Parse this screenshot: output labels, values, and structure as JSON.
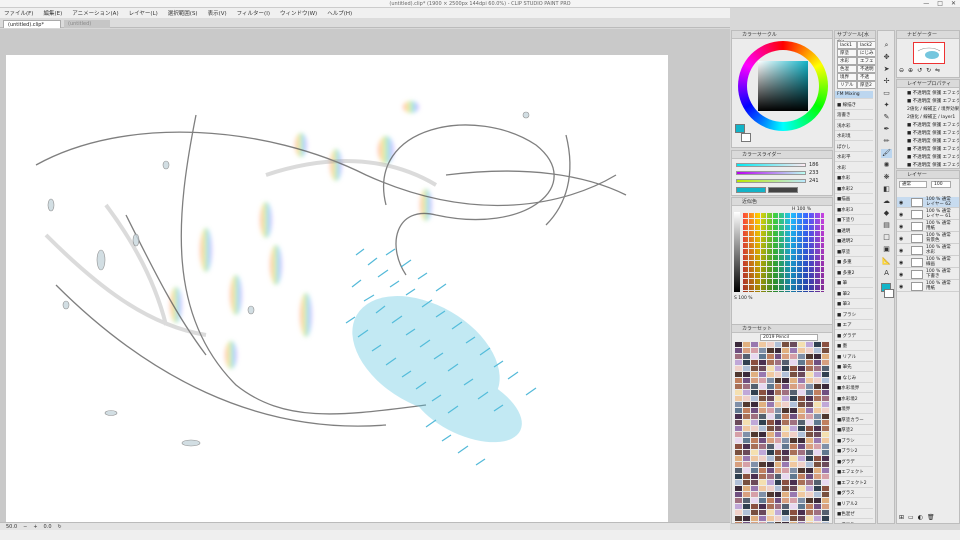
{
  "window": {
    "title": "(untitled).clip* (1900 × 2500px 144dpi 60.0%) - CLIP STUDIO PAINT PRO",
    "controls": [
      "—",
      "□",
      "✕"
    ]
  },
  "menu": [
    "ファイル(F)",
    "編集(E)",
    "アニメーション(A)",
    "レイヤー(L)",
    "選択範囲(S)",
    "表示(V)",
    "フィルター(I)",
    "ウィンドウ(W)",
    "ヘルプ(H)"
  ],
  "tabs": [
    {
      "label": "(untitled).clip*"
    },
    {
      "label": "(untitled)"
    }
  ],
  "status": {
    "zoom": "50.0",
    "angle": "0.0"
  },
  "panels": {
    "color_wheel": "カラーサークル",
    "color_slider": "カラースライダー",
    "approx_color": "近似色",
    "color_set": "カラーセット",
    "color_set_name": "2019 Pencil",
    "subtool": "サブツール[水彩]",
    "navigator": "ナビゲーター",
    "layer_props": "レイヤープロパティ",
    "layers": "レイヤー"
  },
  "slider": {
    "r": "186",
    "g": "233",
    "b": "241"
  },
  "approx": {
    "h_value": "H 100 %",
    "s_value": "S 100 %"
  },
  "subtool_chips": [
    "lack1",
    "lack2",
    "厚塗",
    "にじみ",
    "水彩",
    "エフェ",
    "色混",
    "不透明",
    "境界",
    "不透",
    "リアル",
    "厚塗2"
  ],
  "brushes": [
    "FM Mixing",
    "■ 線描き",
    "溶書き",
    "浅水彩",
    "水彩境",
    "ぼかし",
    "水彩平",
    "水彩",
    "■水彩",
    "■水彩2",
    "■描画",
    "■水彩3",
    "■下塗り",
    "■透明",
    "■透明2",
    "■厚塗",
    "■ 多重",
    "■ 多重2",
    "■ 筆",
    "■ 筆2",
    "■ 筆3",
    "■ ブラシ",
    "■ エア",
    "■ グラデ",
    "■ 墨",
    "■ リアル",
    "■ 筆先",
    "■ なじみ",
    "■水彩境界",
    "■水彩境2",
    "■境界",
    "■厚塗カラー",
    "■厚塗2",
    "■ブラシ",
    "■ブラシ2",
    "■グラデ",
    "■エフェクト",
    "■エフェクト2",
    "■グラス",
    "■リアル2",
    "■色混ぜ",
    "■描画色"
  ],
  "layer_props": [
    "■ 不透明度 保護 エフェクト",
    "■ 不透明度 保護 エフェクト",
    "2値化 / 線補正 / 境界効果",
    "2値化 / 線補正 / layer1",
    "■ 不透明度 保護 エフェクト",
    "■ 不透明度 保護 エフェクト",
    "■ 不透明度 保護 エフェクト",
    "■ 不透明度 保護 エフェクト",
    "■ 不透明度 保護 エフェクト",
    "■ 不透明度 保護 エフェクト"
  ],
  "layer_blend": {
    "mode": "通常",
    "opacity": "100"
  },
  "layers": [
    {
      "name1": "100 % 通常",
      "name2": "レイヤー 62"
    },
    {
      "name1": "100 % 通常",
      "name2": "レイヤー 61"
    },
    {
      "name1": "100 % 通常",
      "name2": "用紙"
    },
    {
      "name1": "100 % 通常",
      "name2": "背景色"
    },
    {
      "name1": "100 % 通常",
      "name2": "水彩"
    },
    {
      "name1": "100 % 通常",
      "name2": "線画"
    },
    {
      "name1": "100 % 通常",
      "name2": "下書き"
    },
    {
      "name1": "100 % 通常",
      "name2": "用紙"
    }
  ],
  "colors": {
    "main": "#12b4c8",
    "sub": "#ffffff",
    "accent": "#3a9fd8"
  }
}
